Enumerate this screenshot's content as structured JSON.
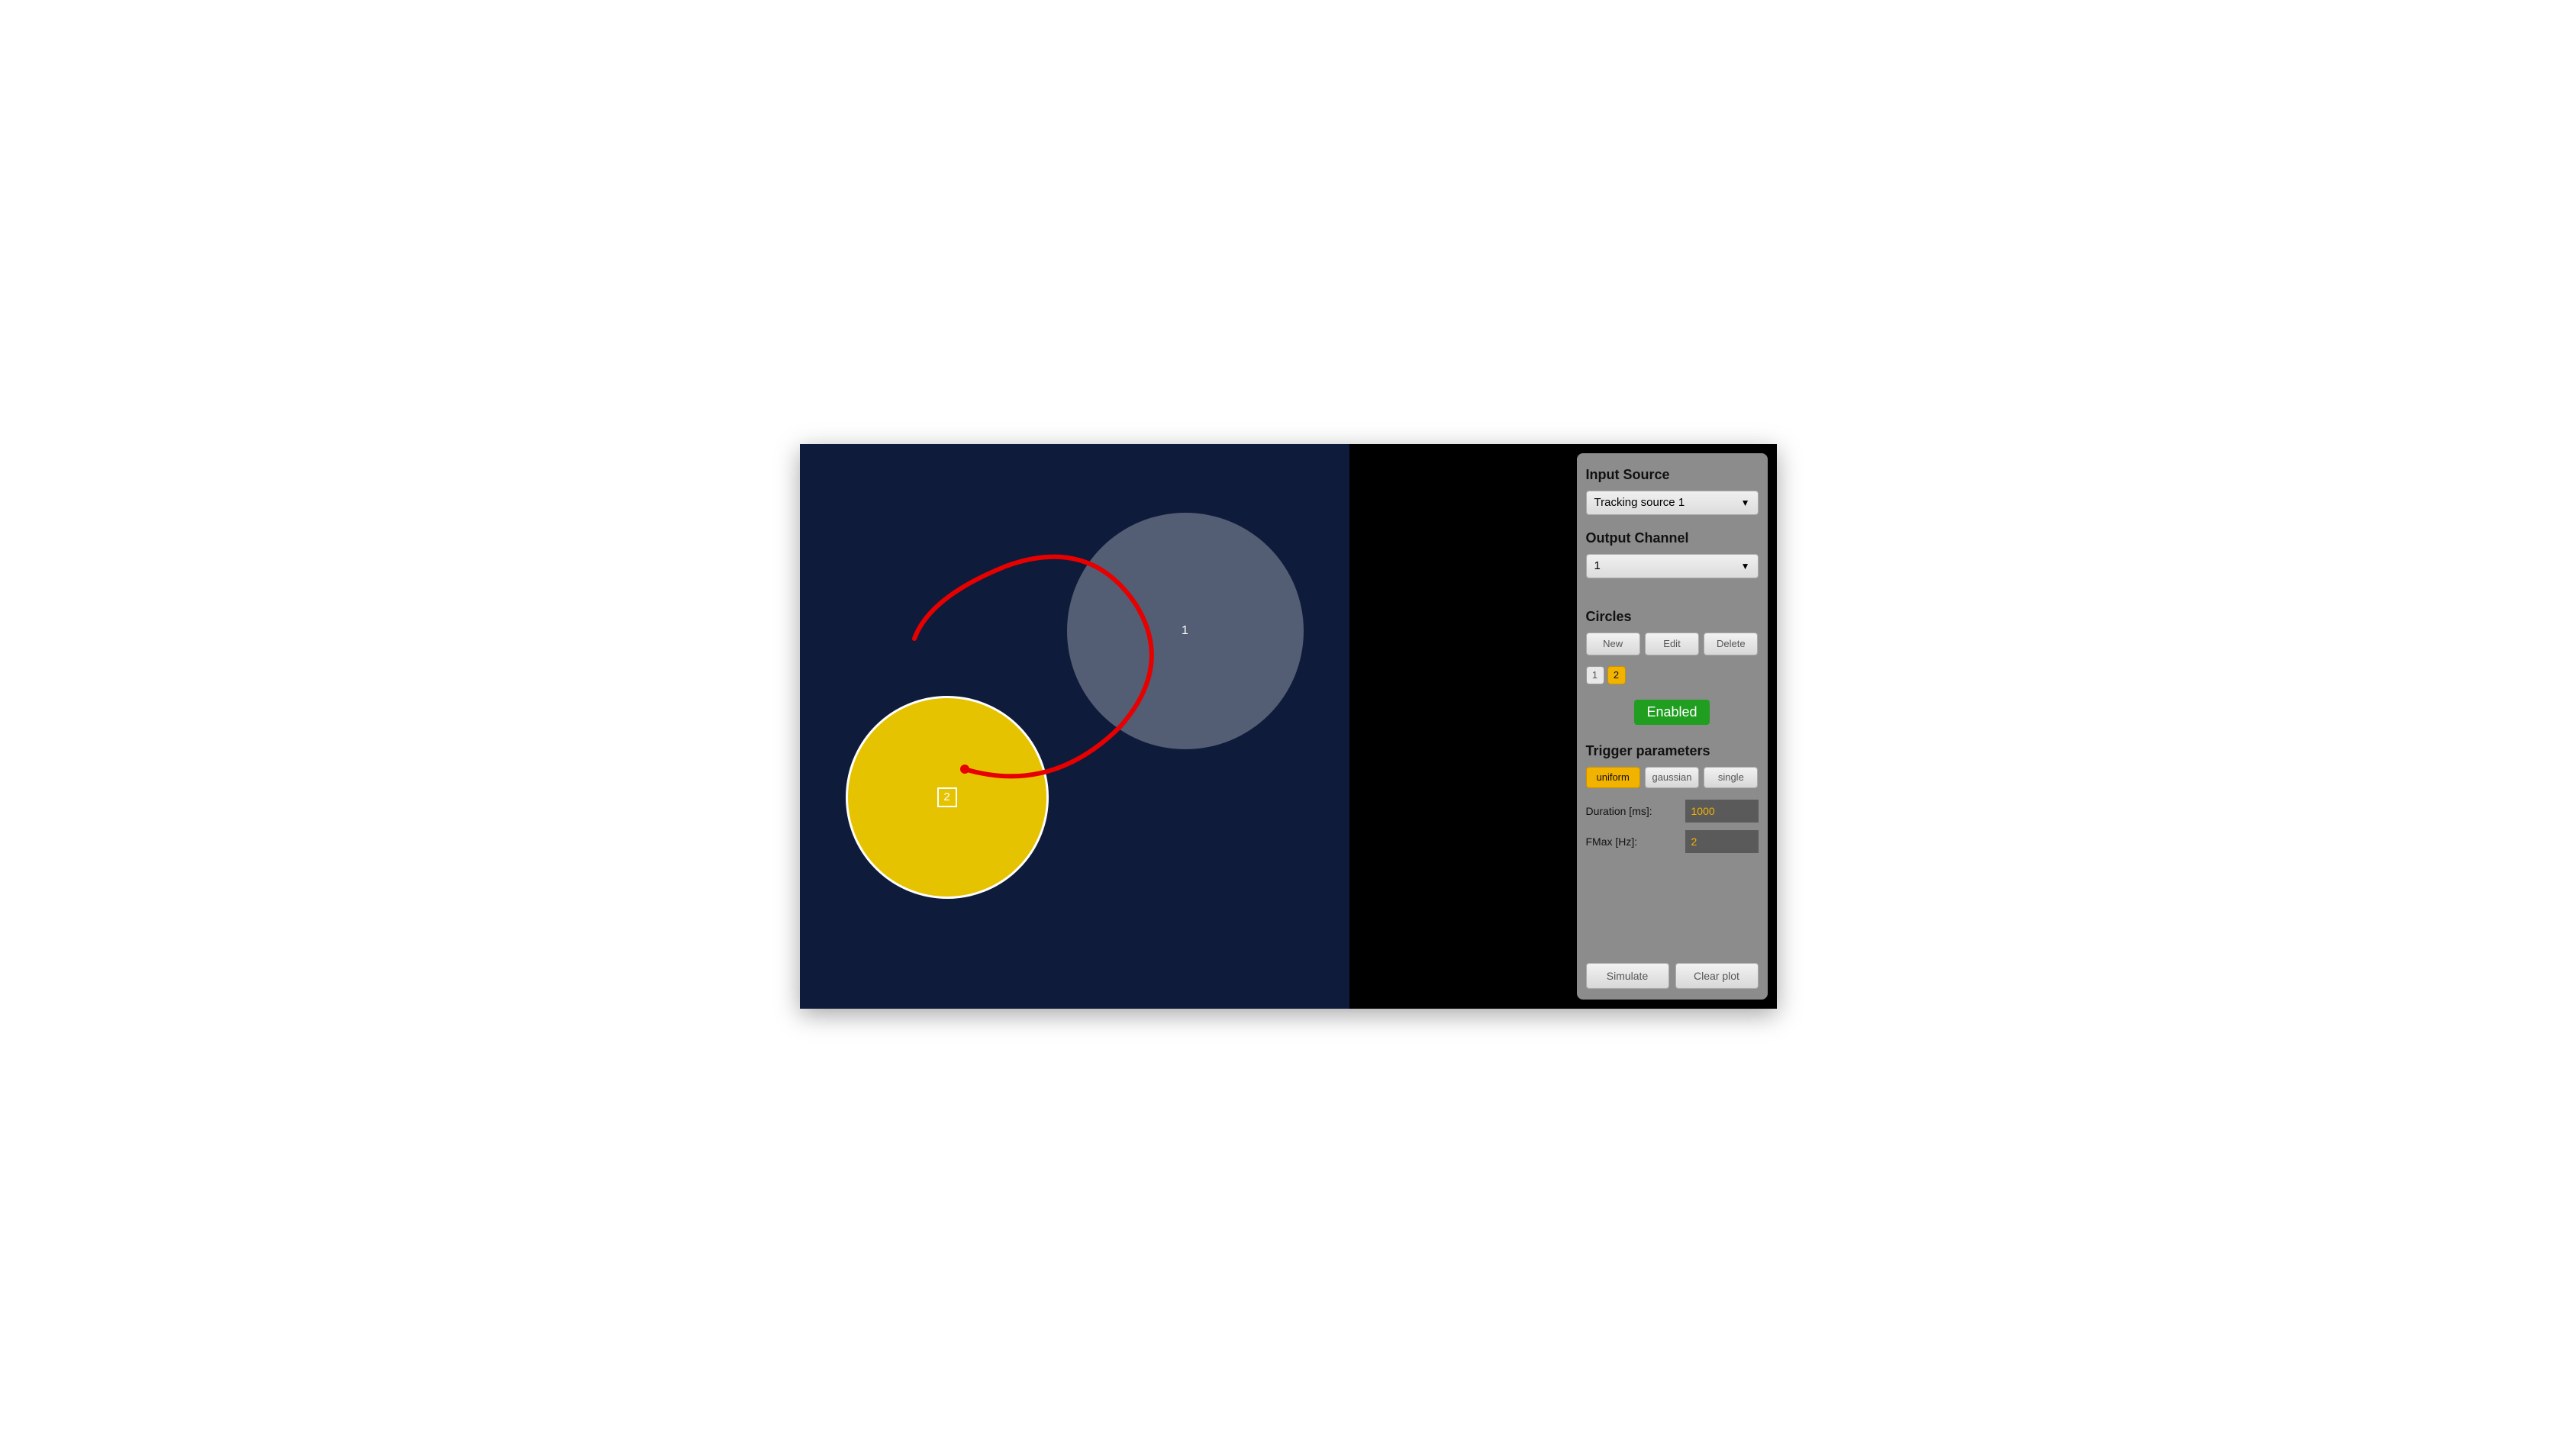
{
  "panel": {
    "input_source_label": "Input Source",
    "input_source_value": "Tracking source 1",
    "output_channel_label": "Output Channel",
    "output_channel_value": "1",
    "circles_label": "Circles",
    "buttons": {
      "new": "New",
      "edit": "Edit",
      "delete": "Delete"
    },
    "circle_chips": [
      "1",
      "2"
    ],
    "selected_chip_index": 1,
    "enabled_label": "Enabled",
    "trigger_label": "Trigger parameters",
    "trigger_modes": [
      "uniform",
      "gaussian",
      "single"
    ],
    "trigger_selected_index": 0,
    "params": {
      "duration_label": "Duration [ms]:",
      "duration_value": "1000",
      "fmax_label": "FMax [Hz]:",
      "fmax_value": "2"
    },
    "footer": {
      "simulate": "Simulate",
      "clear": "Clear plot"
    }
  },
  "plot": {
    "circles": [
      {
        "id": "1",
        "selected": false
      },
      {
        "id": "2",
        "selected": true
      }
    ]
  },
  "colors": {
    "accent": "#f2b200",
    "enabled": "#1f9e1f",
    "trace": "#e60000",
    "canvas_bg": "#0e1b3a"
  }
}
